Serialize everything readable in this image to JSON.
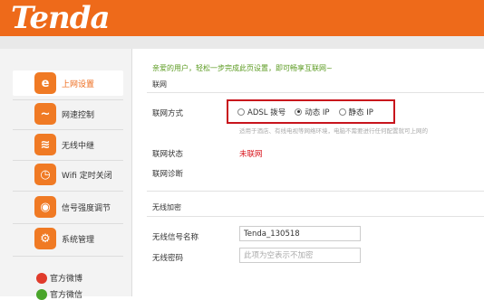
{
  "brand": {
    "logo_text": "Tenda"
  },
  "sidebar": {
    "items": [
      {
        "label": "上网设置",
        "icon": "e-icon",
        "glyph": "e"
      },
      {
        "label": "网速控制",
        "icon": "waveform-icon",
        "glyph": "~"
      },
      {
        "label": "无线中继",
        "icon": "wireless-icon",
        "glyph": "≋"
      },
      {
        "label": "Wifi 定时关闭",
        "icon": "timer-icon",
        "glyph": "◷"
      },
      {
        "label": "信号强度调节",
        "icon": "signal-icon",
        "glyph": "◉"
      },
      {
        "label": "系统管理",
        "icon": "gear-icon",
        "glyph": "⚙"
      }
    ],
    "social": [
      {
        "label": "官方微博",
        "icon": "weibo-icon"
      },
      {
        "label": "官方微信",
        "icon": "wechat-icon"
      }
    ]
  },
  "main": {
    "welcome": "亲爱的用户，轻松一步完成此页设置，即可畅享互联网~",
    "network_section": "联网",
    "connection_type_label": "联网方式",
    "connection_options": [
      {
        "label": "ADSL 拨号",
        "checked": false
      },
      {
        "label": "动态 IP",
        "checked": true
      },
      {
        "label": "静态 IP",
        "checked": false
      }
    ],
    "connection_hint": "适用于酒店、有线电视等网络环境，电脑不需要进行任何配置就可上网的",
    "status_label": "联网状态",
    "status_value": "未联网",
    "diagnosis_label": "联网诊断",
    "wireless_section": "无线加密",
    "ssid_label": "无线信号名称",
    "ssid_value": "Tenda_130518",
    "password_label": "无线密码",
    "password_placeholder": "此项为空表示不加密"
  },
  "colors": {
    "brand_orange": "#ee6a1a",
    "status_red": "#d8121a",
    "highlight_box": "#c8141c",
    "welcome_green": "#5a9a1f"
  }
}
